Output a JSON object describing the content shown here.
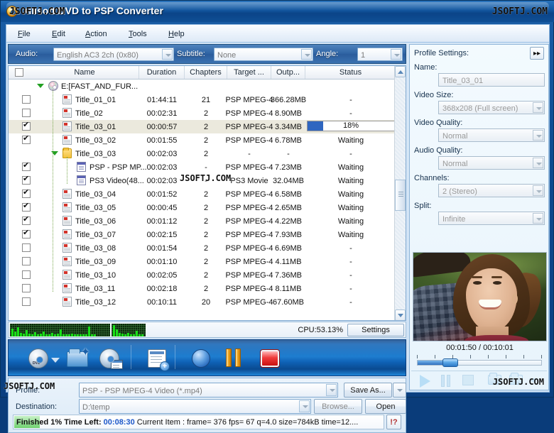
{
  "window": {
    "title": "Xilisoft DVD to PSP Converter",
    "watermark": "JSOFTJ.COM"
  },
  "menubar": {
    "items": [
      {
        "label": "File"
      },
      {
        "label": "Edit"
      },
      {
        "label": "Action"
      },
      {
        "label": "Tools"
      },
      {
        "label": "Help"
      }
    ]
  },
  "audiobar": {
    "audio_label": "Audio:",
    "audio_value": "English AC3 2ch (0x80)",
    "subtitle_label": "Subtitle:",
    "subtitle_value": "None",
    "angle_label": "Angle:",
    "angle_value": "1"
  },
  "list": {
    "columns": [
      "Name",
      "Duration",
      "Chapters",
      "Target ...",
      "Outp...",
      "Status"
    ],
    "rows": [
      {
        "depth": 0,
        "icon": "disc-icon",
        "check": "none",
        "name": "E:[FAST_AND_FUR...",
        "duration": "",
        "chapters": "",
        "target": "",
        "output": "",
        "status": "",
        "expander": true
      },
      {
        "depth": 1,
        "icon": "title-icon",
        "check": "off",
        "name": "Title_01_01",
        "duration": "01:44:11",
        "chapters": "21",
        "target": "PSP MPEG-4",
        "output": "366.28MB",
        "status": "-"
      },
      {
        "depth": 1,
        "icon": "title-icon",
        "check": "off",
        "name": "Title_02",
        "duration": "00:02:31",
        "chapters": "2",
        "target": "PSP MPEG-4",
        "output": "8.90MB",
        "status": "-"
      },
      {
        "depth": 1,
        "icon": "title-icon",
        "check": "on",
        "name": "Title_03_01",
        "duration": "00:00:57",
        "chapters": "2",
        "target": "PSP MPEG-4",
        "output": "3.34MB",
        "status": "18%",
        "progress": 18,
        "selected": true
      },
      {
        "depth": 1,
        "icon": "title-icon",
        "check": "on",
        "name": "Title_03_02",
        "duration": "00:01:55",
        "chapters": "2",
        "target": "PSP MPEG-4",
        "output": "6.78MB",
        "status": "Waiting"
      },
      {
        "depth": 1,
        "icon": "folder-icon",
        "check": "none",
        "name": "Title_03_03",
        "duration": "00:02:03",
        "chapters": "2",
        "target": "-",
        "output": "-",
        "status": "-",
        "expander": true
      },
      {
        "depth": 2,
        "icon": "profile-icon",
        "check": "on",
        "name": "PSP - PSP MP...",
        "duration": "00:02:03",
        "chapters": "-",
        "target": "PSP MPEG-4",
        "output": "7.23MB",
        "status": "Waiting"
      },
      {
        "depth": 2,
        "icon": "profile-icon",
        "check": "on",
        "name": "PS3 Video(48...",
        "duration": "00:02:03",
        "chapters": "-",
        "target": "PS3 Movie",
        "output": "32.04MB",
        "status": "Waiting"
      },
      {
        "depth": 1,
        "icon": "title-icon",
        "check": "on",
        "name": "Title_03_04",
        "duration": "00:01:52",
        "chapters": "2",
        "target": "PSP MPEG-4",
        "output": "6.58MB",
        "status": "Waiting"
      },
      {
        "depth": 1,
        "icon": "title-icon",
        "check": "on",
        "name": "Title_03_05",
        "duration": "00:00:45",
        "chapters": "2",
        "target": "PSP MPEG-4",
        "output": "2.65MB",
        "status": "Waiting"
      },
      {
        "depth": 1,
        "icon": "title-icon",
        "check": "on",
        "name": "Title_03_06",
        "duration": "00:01:12",
        "chapters": "2",
        "target": "PSP MPEG-4",
        "output": "4.22MB",
        "status": "Waiting"
      },
      {
        "depth": 1,
        "icon": "title-icon",
        "check": "on",
        "name": "Title_03_07",
        "duration": "00:02:15",
        "chapters": "2",
        "target": "PSP MPEG-4",
        "output": "7.93MB",
        "status": "Waiting"
      },
      {
        "depth": 1,
        "icon": "title-icon",
        "check": "off",
        "name": "Title_03_08",
        "duration": "00:01:54",
        "chapters": "2",
        "target": "PSP MPEG-4",
        "output": "6.69MB",
        "status": "-"
      },
      {
        "depth": 1,
        "icon": "title-icon",
        "check": "off",
        "name": "Title_03_09",
        "duration": "00:01:10",
        "chapters": "2",
        "target": "PSP MPEG-4",
        "output": "4.11MB",
        "status": "-"
      },
      {
        "depth": 1,
        "icon": "title-icon",
        "check": "off",
        "name": "Title_03_10",
        "duration": "00:02:05",
        "chapters": "2",
        "target": "PSP MPEG-4",
        "output": "7.36MB",
        "status": "-"
      },
      {
        "depth": 1,
        "icon": "title-icon",
        "check": "off",
        "name": "Title_03_11",
        "duration": "00:02:18",
        "chapters": "2",
        "target": "PSP MPEG-4",
        "output": "8.11MB",
        "status": "-"
      },
      {
        "depth": 1,
        "icon": "title-icon",
        "check": "off",
        "name": "Title_03_12",
        "duration": "00:10:11",
        "chapters": "20",
        "target": "PSP MPEG-4",
        "output": "67.60MB",
        "status": "-"
      }
    ]
  },
  "cpu": {
    "label": "CPU:53.13%",
    "settings_label": "Settings"
  },
  "toolbar": {
    "buttons": [
      {
        "name": "load-dvd-icon",
        "label": "Load DVD"
      },
      {
        "name": "dropdown-arrow-icon",
        "label": ""
      },
      {
        "name": "add-folder-icon",
        "label": "Add Folder"
      },
      {
        "name": "open-iso-icon",
        "label": "Open ISO"
      },
      {
        "name": "add-profile-icon",
        "label": "Add Profile"
      },
      {
        "name": "encode-icon",
        "label": "Encode"
      },
      {
        "name": "pause-icon",
        "label": "Pause"
      },
      {
        "name": "stop-icon",
        "label": "Stop"
      }
    ]
  },
  "bottom": {
    "profile_label": "Profile:",
    "profile_value": "PSP - PSP MPEG-4 Video  (*.mp4)",
    "save_as_label": "Save As...",
    "destination_label": "Destination:",
    "destination_value": "D:\\temp",
    "browse_label": "Browse...",
    "open_label": "Open",
    "status_finished": "Finished 1%",
    "status_timeleft_label": "Time Left:",
    "status_timeleft_value": "00:08:30",
    "status_detail": "Current Item : frame=  376 fps= 67 q=4.0 size=784kB time=12....",
    "help_label": "!?"
  },
  "profile_panel": {
    "title": "Profile Settings:",
    "expand_label": "▸▸",
    "fields": [
      {
        "label": "Name:",
        "value": "Title_03_01",
        "dropdown": false
      },
      {
        "label": "Video Size:",
        "value": "368x208 (Full screen)",
        "dropdown": true
      },
      {
        "label": "Video Quality:",
        "value": "Normal",
        "dropdown": true
      },
      {
        "label": "Audio Quality:",
        "value": "Normal",
        "dropdown": true
      },
      {
        "label": "Channels:",
        "value": "2 (Stereo)",
        "dropdown": true
      },
      {
        "label": "Split:",
        "value": "Infinite",
        "dropdown": true
      }
    ]
  },
  "player": {
    "timecode": "00:01:50 / 00:10:01",
    "current": "00:01:50",
    "total": "00:10:01",
    "progress_percent": 18,
    "controls": [
      "play-icon",
      "pause-icon",
      "stop-icon",
      "snapshot-icon",
      "open-folder-icon",
      "chevron-down-icon"
    ]
  },
  "colors": {
    "accent": "#2f66c0",
    "titlebar": "#11559e",
    "toolbar": "#1f7ed0",
    "progress_green": "#6fd16f",
    "timeleft_blue": "#1d58c9",
    "stop_red": "#c91111"
  }
}
